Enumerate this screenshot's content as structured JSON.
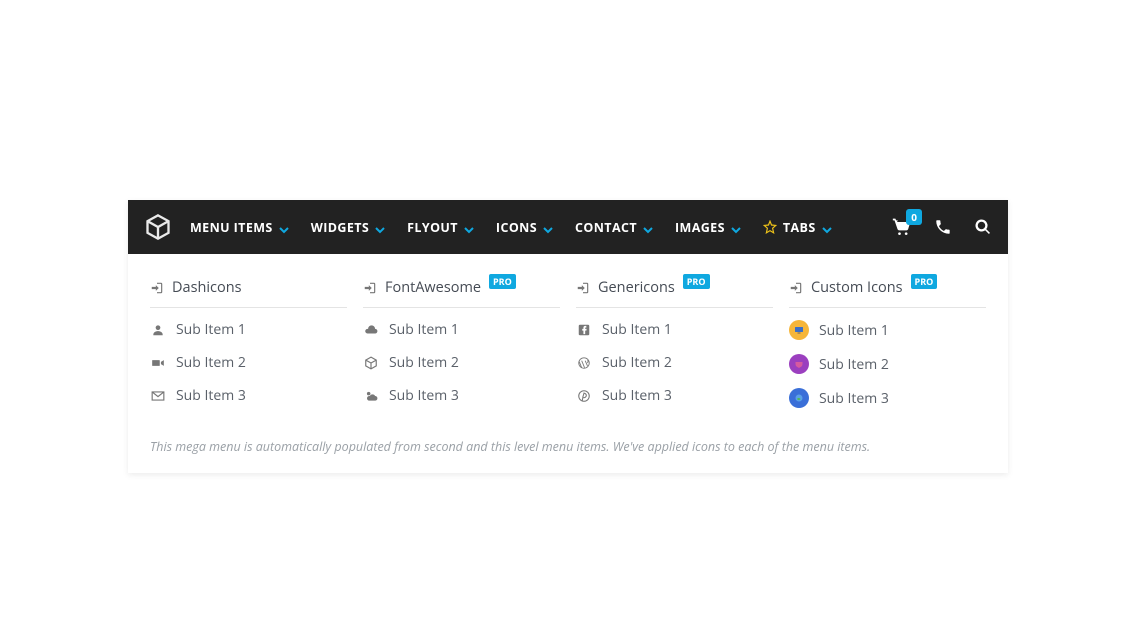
{
  "nav": {
    "items": [
      {
        "label": "MENU ITEMS"
      },
      {
        "label": "WIDGETS"
      },
      {
        "label": "FLYOUT"
      },
      {
        "label": "ICONS"
      },
      {
        "label": "CONTACT"
      },
      {
        "label": "IMAGES"
      },
      {
        "label": "TABS"
      }
    ],
    "cart_count": "0"
  },
  "mega": {
    "columns": [
      {
        "title": "Dashicons",
        "pro": false,
        "items": [
          {
            "label": "Sub Item 1"
          },
          {
            "label": "Sub Item 2"
          },
          {
            "label": "Sub Item 3"
          }
        ]
      },
      {
        "title": "FontAwesome",
        "pro": true,
        "items": [
          {
            "label": "Sub Item 1"
          },
          {
            "label": "Sub Item 2"
          },
          {
            "label": "Sub Item 3"
          }
        ]
      },
      {
        "title": "Genericons",
        "pro": true,
        "items": [
          {
            "label": "Sub Item 1"
          },
          {
            "label": "Sub Item 2"
          },
          {
            "label": "Sub Item 3"
          }
        ]
      },
      {
        "title": "Custom Icons",
        "pro": true,
        "items": [
          {
            "label": "Sub Item 1"
          },
          {
            "label": "Sub Item 2"
          },
          {
            "label": "Sub Item 3"
          }
        ]
      }
    ],
    "pro_badge_text": "PRO",
    "footnote": "This mega menu is automatically populated from second and this level menu items. We've applied icons to each of the menu items."
  }
}
